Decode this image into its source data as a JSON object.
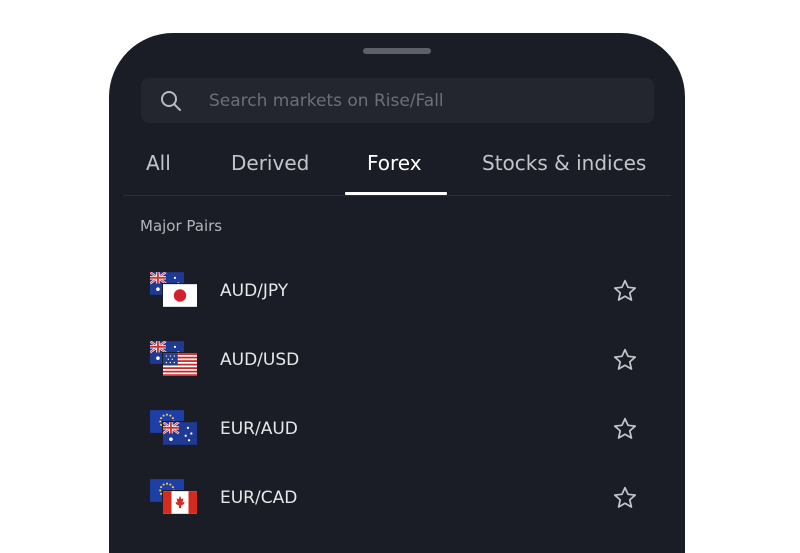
{
  "search": {
    "placeholder": "Search markets on Rise/Fall",
    "icon": "search-icon"
  },
  "tabs": [
    {
      "label": "All",
      "active": false
    },
    {
      "label": "Derived",
      "active": false
    },
    {
      "label": "Forex",
      "active": true
    },
    {
      "label": "Stocks & indices",
      "active": false
    }
  ],
  "section": {
    "title": "Major Pairs"
  },
  "markets": [
    {
      "label": "AUD/JPY",
      "base": "AU",
      "quote": "JP",
      "favorite": false
    },
    {
      "label": "AUD/USD",
      "base": "AU",
      "quote": "US",
      "favorite": false
    },
    {
      "label": "EUR/AUD",
      "base": "EU",
      "quote": "AU",
      "favorite": false
    },
    {
      "label": "EUR/CAD",
      "base": "EU",
      "quote": "CA",
      "favorite": false
    }
  ],
  "colors": {
    "background": "#1a1d25",
    "search_bg": "#23262f",
    "text_primary": "#e7e8ea",
    "text_muted": "#6c6f77",
    "accent": "#ffffff"
  }
}
